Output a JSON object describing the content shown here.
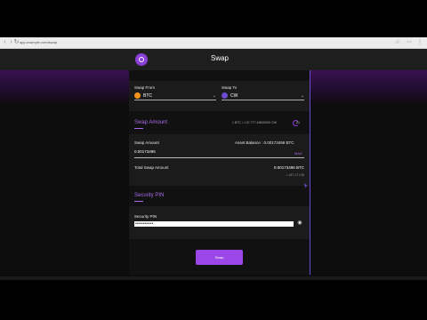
{
  "browser": {
    "url": "app.example.com/swap",
    "colors": {
      "toolbar": "#ececec"
    }
  },
  "header": {
    "title": "Swap"
  },
  "swap": {
    "from_label": "Swap From",
    "from_coin": "BTC",
    "to_label": "Swap To",
    "to_coin": "CW",
    "swap_amount_title": "Swap Amount",
    "rate_text": "1 BTC = 137,777.49600000 CW",
    "refresh_count": "21"
  },
  "amount": {
    "label": "Swap Amount",
    "balance_label": "Asset Balance : 0.00173496 BTC",
    "value": "0.00173496",
    "max_label": "MAX",
    "total_label": "Total Swap Amount",
    "total_value": "0.00173496 BTC",
    "total_sub": "= 187.17 CW"
  },
  "pin": {
    "section_title": "Security PIN",
    "label": "Security PIN",
    "dots": "••••••••••"
  },
  "actions": {
    "swap_label": "Swap"
  },
  "colors": {
    "accent": "#9b46e6",
    "bg": "#0c0c0c",
    "card": "#1b1b1b",
    "btc": "#f7931a",
    "cw": "#6d4bd0"
  },
  "icons": {
    "logo": "logo-icon",
    "btc": "btc-icon",
    "cw": "cw-icon",
    "eye": "eye-icon"
  }
}
